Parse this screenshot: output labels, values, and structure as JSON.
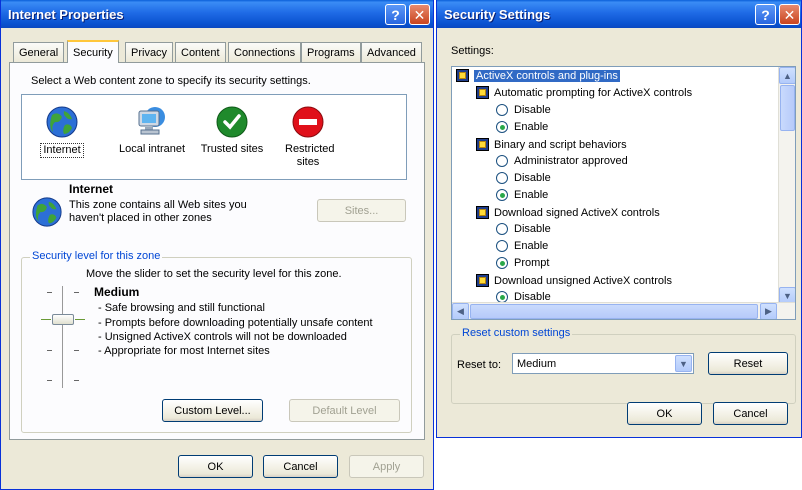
{
  "internet_properties": {
    "title": "Internet Properties",
    "help_btn": "?",
    "close_btn": "✕",
    "tabs": [
      "General",
      "Security",
      "Privacy",
      "Content",
      "Connections",
      "Programs",
      "Advanced"
    ],
    "zone_prompt": "Select a Web content zone to specify its security settings.",
    "zones": [
      {
        "label": "Internet",
        "icon": "globe-icon"
      },
      {
        "label": "Local intranet",
        "icon": "computer-icon"
      },
      {
        "label": "Trusted sites",
        "icon": "checkmark-icon"
      },
      {
        "label": "Restricted sites",
        "icon": "no-entry-icon"
      }
    ],
    "selected_zone_name": "Internet",
    "zone_description_1": "This zone contains all Web sites you",
    "zone_description_2": "haven't placed in other zones",
    "sites_button": "Sites...",
    "security_level_group": "Security level for this zone",
    "slider_hint": "Move the slider to set the security level for this zone.",
    "level_name": "Medium",
    "level_bullets": [
      "- Safe browsing and still functional",
      "- Prompts before downloading potentially unsafe content",
      "- Unsigned ActiveX controls will not be downloaded",
      "- Appropriate for most Internet sites"
    ],
    "custom_level_button": "Custom Level...",
    "default_level_button": "Default Level",
    "ok_button": "OK",
    "cancel_button": "Cancel",
    "apply_button": "Apply"
  },
  "security_settings": {
    "title": "Security Settings",
    "help_btn": "?",
    "close_btn": "✕",
    "settings_label": "Settings:",
    "items": [
      {
        "kind": "category",
        "text": "ActiveX controls and plug-ins",
        "selected": true
      },
      {
        "kind": "setting",
        "text": "Automatic prompting for ActiveX controls"
      },
      {
        "kind": "option",
        "text": "Disable",
        "checked": false
      },
      {
        "kind": "option",
        "text": "Enable",
        "checked": true
      },
      {
        "kind": "setting",
        "text": "Binary and script behaviors"
      },
      {
        "kind": "option",
        "text": "Administrator approved",
        "checked": false
      },
      {
        "kind": "option",
        "text": "Disable",
        "checked": false
      },
      {
        "kind": "option",
        "text": "Enable",
        "checked": true
      },
      {
        "kind": "setting",
        "text": "Download signed ActiveX controls"
      },
      {
        "kind": "option",
        "text": "Disable",
        "checked": false
      },
      {
        "kind": "option",
        "text": "Enable",
        "checked": false
      },
      {
        "kind": "option",
        "text": "Prompt",
        "checked": true
      },
      {
        "kind": "setting",
        "text": "Download unsigned ActiveX controls"
      },
      {
        "kind": "option",
        "text": "Disable",
        "checked": true
      }
    ],
    "reset_group": "Reset custom settings",
    "reset_to_label": "Reset to:",
    "reset_to_value": "Medium",
    "reset_button": "Reset",
    "ok_button": "OK",
    "cancel_button": "Cancel"
  }
}
